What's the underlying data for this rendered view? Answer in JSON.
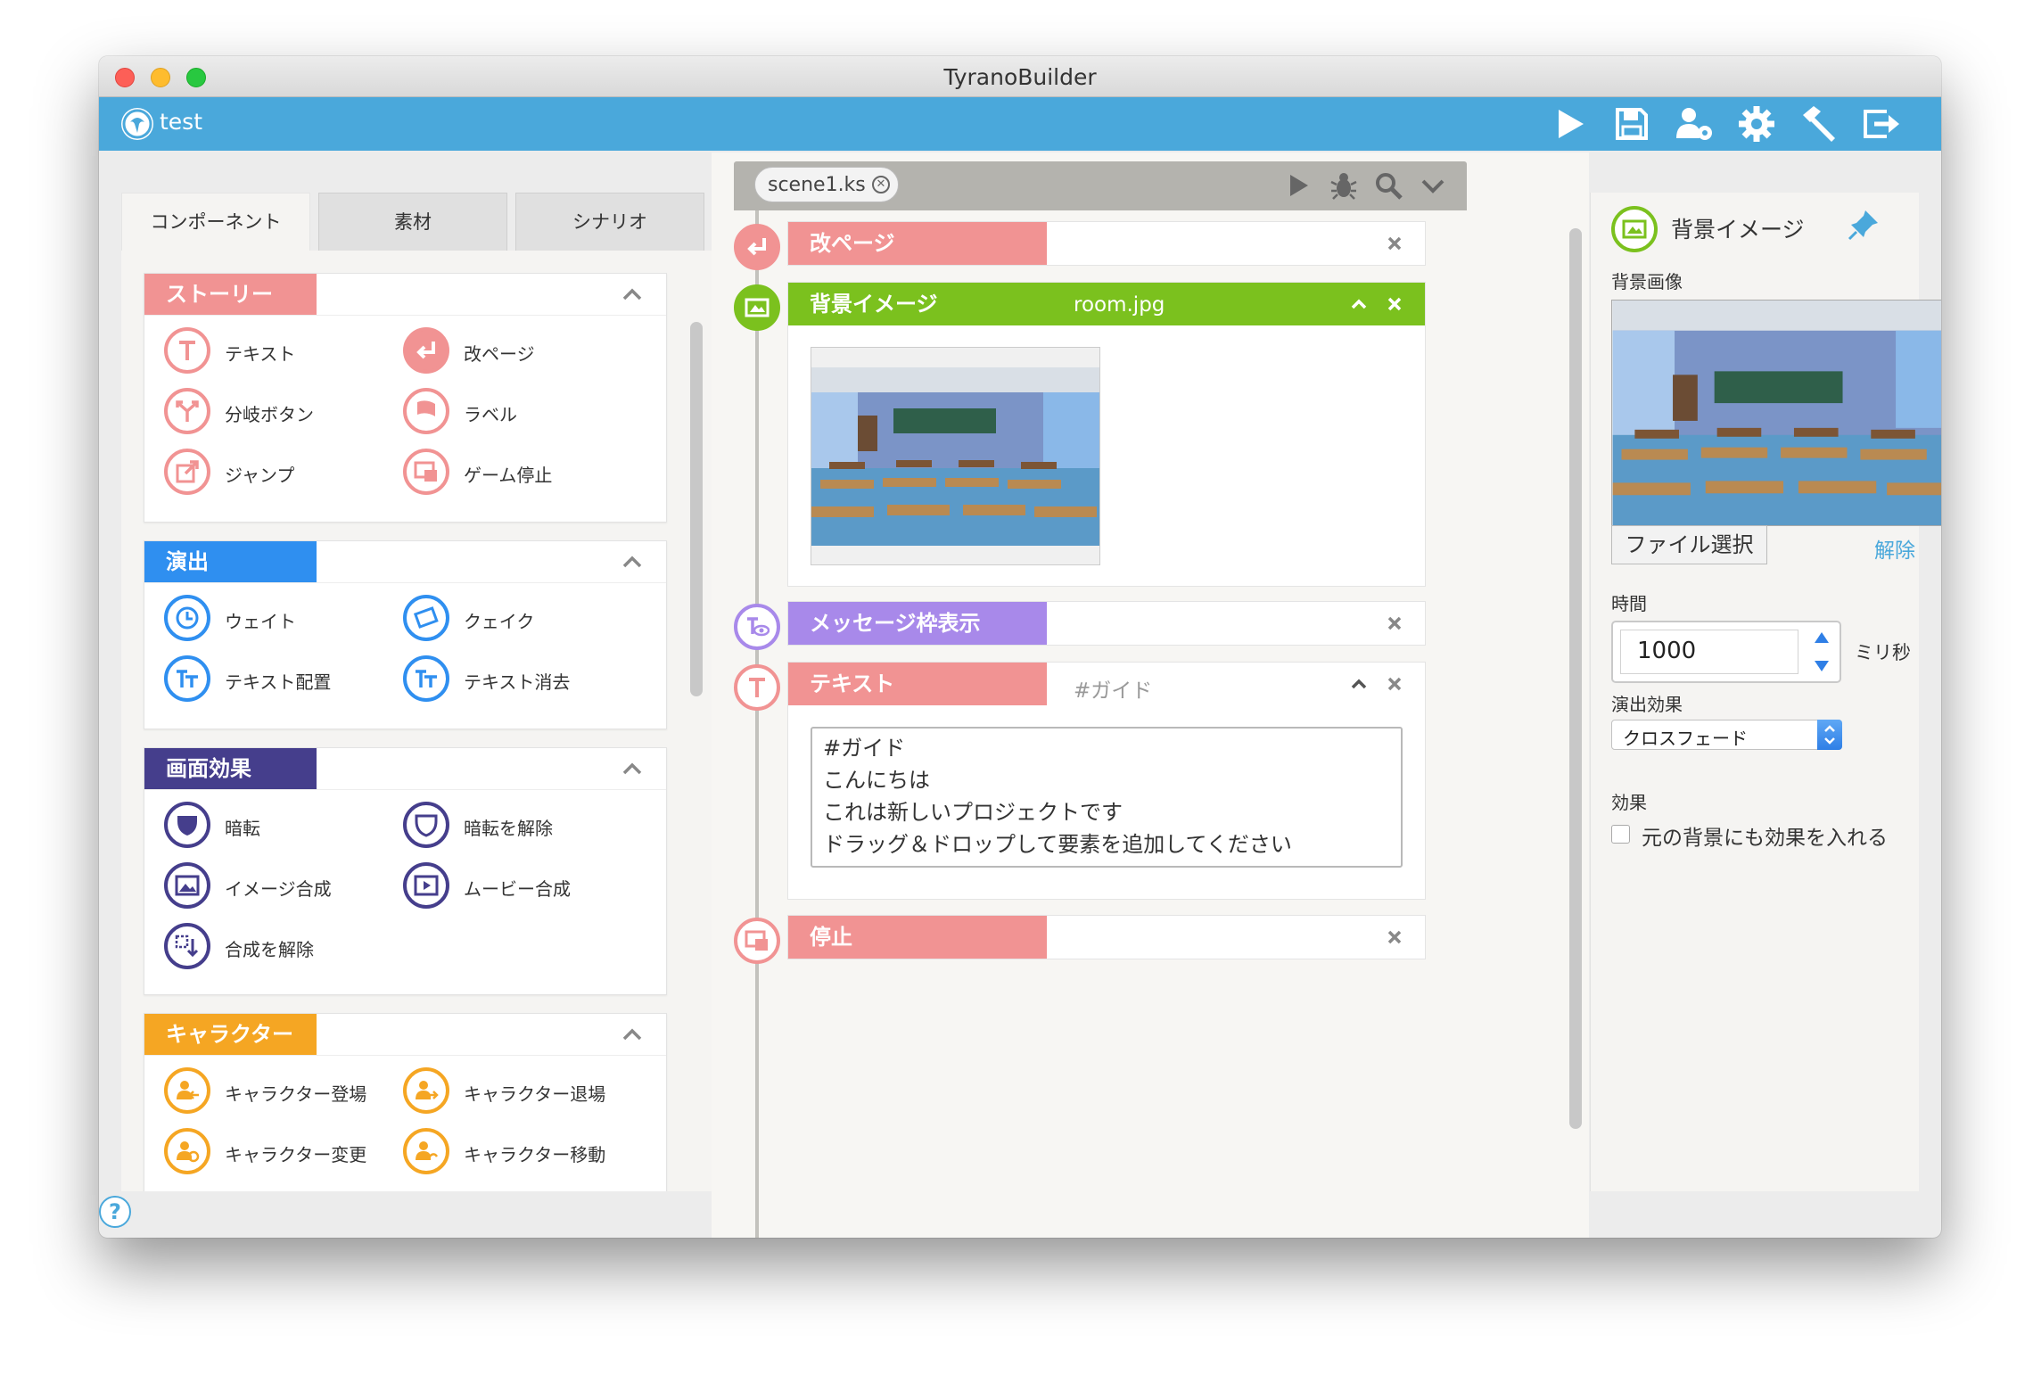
{
  "window": {
    "title": "TyranoBuilder"
  },
  "appbar": {
    "project_name": "test"
  },
  "left_tabs": [
    {
      "label": "コンポーネント",
      "active": true
    },
    {
      "label": "素材",
      "active": false
    },
    {
      "label": "シナリオ",
      "active": false
    }
  ],
  "sections": [
    {
      "label": "ストーリー",
      "color": "#f19393",
      "items": [
        "テキスト",
        "改ページ",
        "分岐ボタン",
        "ラベル",
        "ジャンプ",
        "ゲーム停止"
      ]
    },
    {
      "label": "演出",
      "color": "#2f8ff0",
      "items": [
        "ウェイト",
        "クェイク",
        "テキスト配置",
        "テキスト消去"
      ]
    },
    {
      "label": "画面効果",
      "color": "#453e8c",
      "items": [
        "暗転",
        "暗転を解除",
        "イメージ合成",
        "ムービー合成",
        "合成を解除"
      ]
    },
    {
      "label": "キャラクター",
      "color": "#f5a623",
      "items": [
        "キャラクター登場",
        "キャラクター退場",
        "キャラクター変更",
        "キャラクター移動"
      ]
    }
  ],
  "scene": {
    "tab_label": "scene1.ks"
  },
  "blocks": [
    {
      "label": "改ページ",
      "color": "#f19393"
    },
    {
      "label": "背景イメージ",
      "color": "#7bc11e",
      "param": "room.jpg"
    },
    {
      "label": "メッセージ枠表示",
      "color": "#a889ea"
    },
    {
      "label": "テキスト",
      "color": "#f19393",
      "param": "#ガイド",
      "lines": [
        "#ガイド",
        "こんにちは",
        "これは新しいプロジェクトです",
        "ドラッグ＆ドロップして要素を追加してください"
      ]
    },
    {
      "label": "停止",
      "color": "#f19393"
    }
  ],
  "properties": {
    "title": "背景イメージ",
    "image_label": "背景画像",
    "file_button": "ファイル選択",
    "release_link": "解除",
    "time_label": "時間",
    "time_value": "1000",
    "time_unit": "ミリ秒",
    "effect_label": "演出効果",
    "effect_value": "クロスフェード",
    "fx_label": "効果",
    "fx_checkbox": "元の背景にも効果を入れる"
  },
  "help": {
    "label": "?"
  }
}
